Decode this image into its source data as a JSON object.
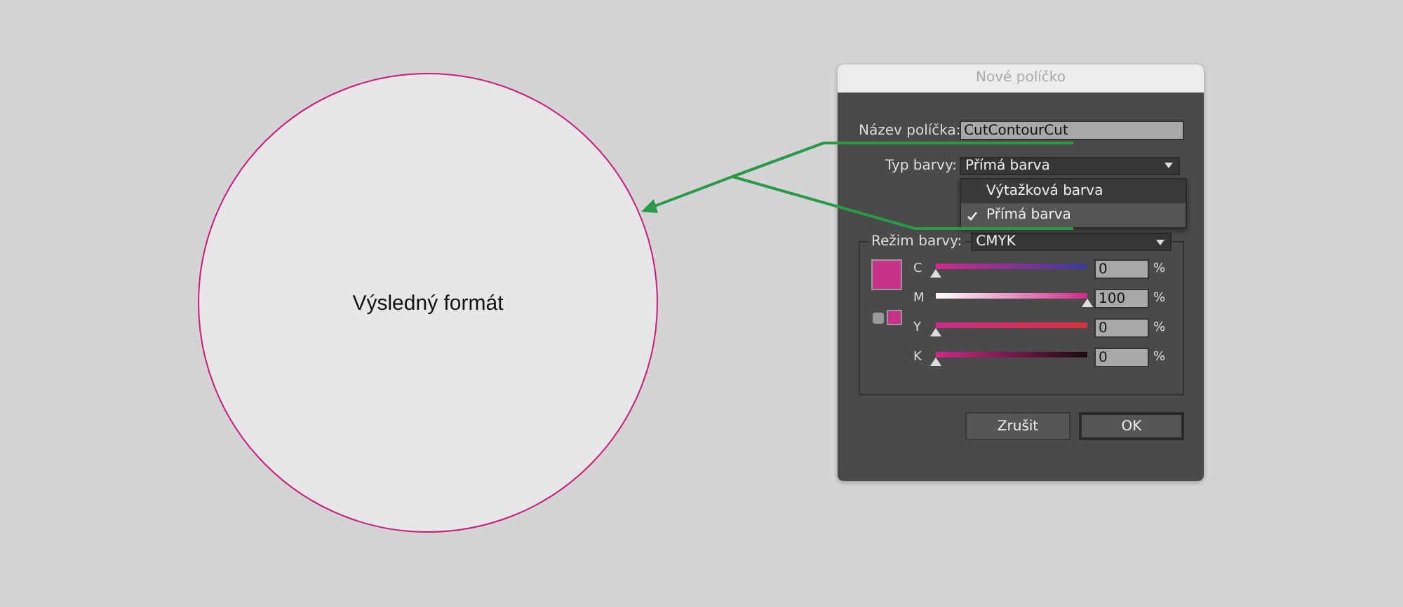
{
  "canvas": {
    "label": "Výsledný formát"
  },
  "dialog": {
    "title": "Nové políčko",
    "name_field": {
      "label": "Název políčka:",
      "value": "CutContourCut"
    },
    "color_type": {
      "label": "Typ barvy:",
      "value": "Přímá barva"
    },
    "color_type_menu": [
      {
        "label": "Výtažková barva",
        "selected": false
      },
      {
        "label": "Přímá barva",
        "selected": true
      }
    ],
    "color_mode": {
      "label": "Režim barvy:",
      "value": "CMYK"
    },
    "channels": [
      {
        "name": "C",
        "level": 0,
        "value": "0",
        "unit": "%"
      },
      {
        "name": "M",
        "level": 1,
        "value": "100",
        "unit": "%"
      },
      {
        "name": "Y",
        "level": 0,
        "value": "0",
        "unit": "%"
      },
      {
        "name": "K",
        "level": 0,
        "value": "0",
        "unit": "%"
      }
    ],
    "buttons": [
      {
        "label": "Zrušit",
        "default": false
      },
      {
        "label": "OK",
        "default": true
      }
    ]
  }
}
